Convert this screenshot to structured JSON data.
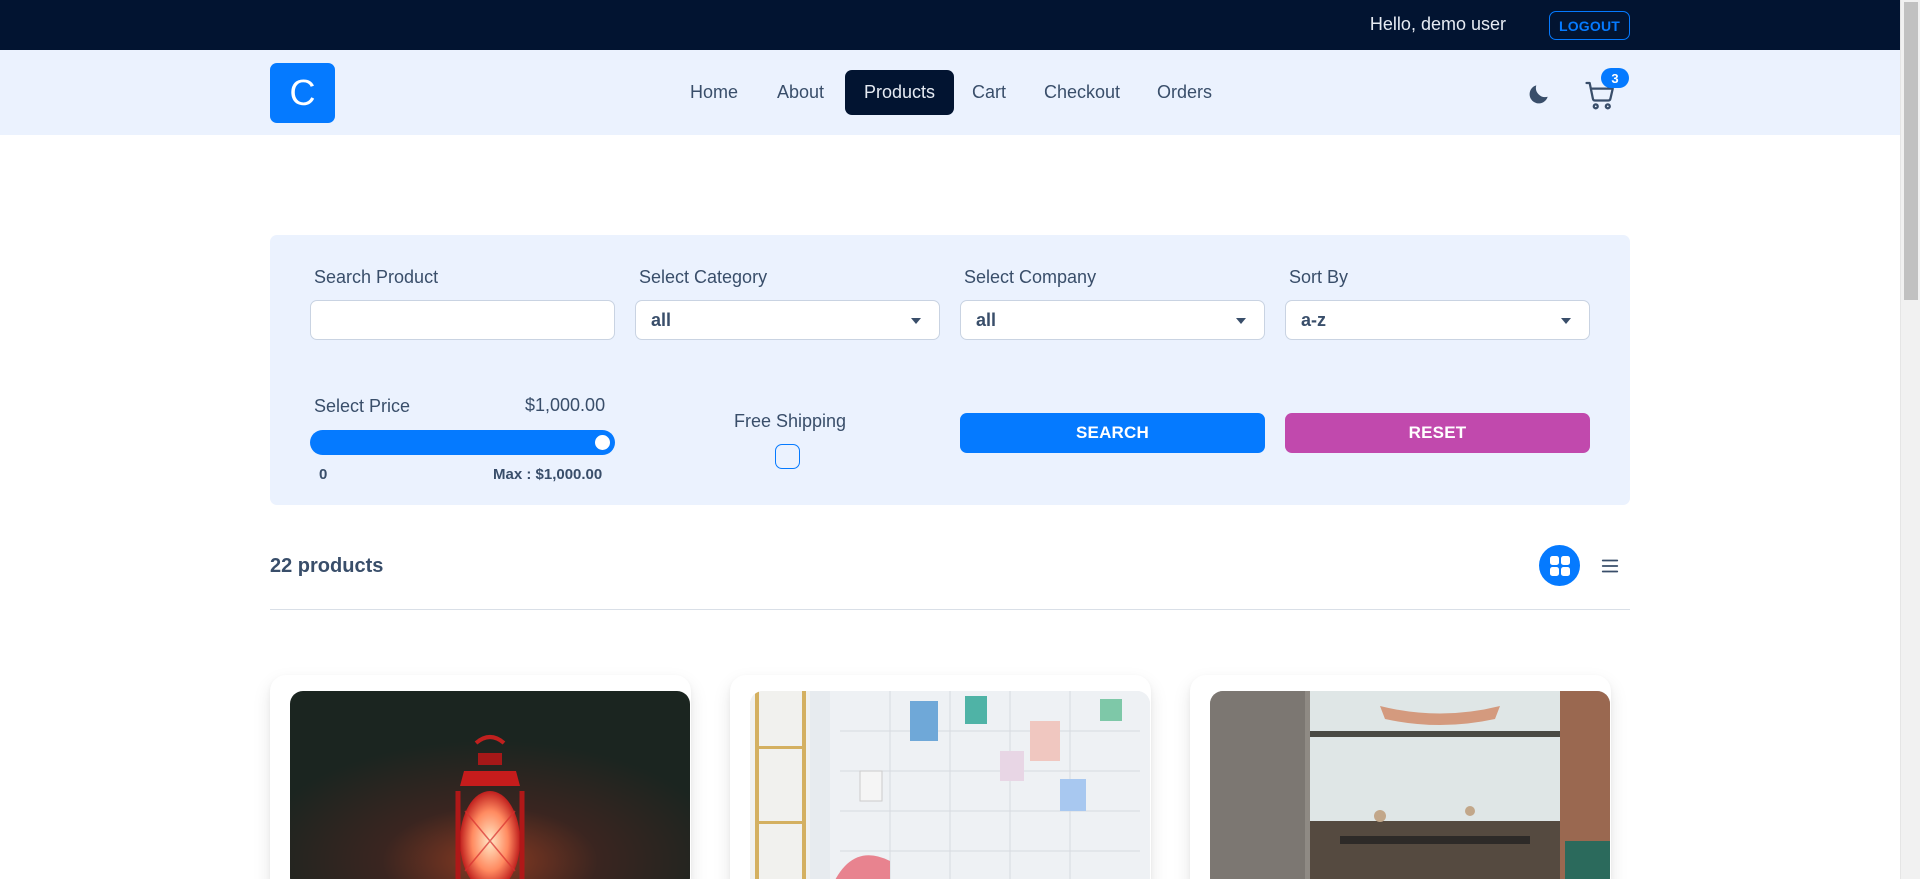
{
  "topbar": {
    "greeting": "Hello, demo user",
    "logout_label": "LOGOUT"
  },
  "navbar": {
    "logo_letter": "C",
    "links": [
      {
        "label": "Home"
      },
      {
        "label": "About"
      },
      {
        "label": "Products"
      },
      {
        "label": "Cart"
      },
      {
        "label": "Checkout"
      },
      {
        "label": "Orders"
      }
    ],
    "active_link": "Products",
    "theme_icon": "moon-icon",
    "cart_icon": "cart-icon",
    "cart_count": "3"
  },
  "filters": {
    "search_label": "Search Product",
    "search_value": "",
    "category_label": "Select Category",
    "category_value": "all",
    "company_label": "Select Company",
    "company_value": "all",
    "sort_label": "Sort By",
    "sort_value": "a-z",
    "price_label": "Select Price",
    "price_value": "$1,000.00",
    "price_min_label": "0",
    "price_max_label": "Max : $1,000.00",
    "price_level": 1.0,
    "shipping_label": "Free Shipping",
    "shipping_checked": false,
    "search_button": "SEARCH",
    "reset_button": "RESET"
  },
  "products": {
    "count_label": "22 products",
    "view_grid_icon": "grid-icon",
    "view_list_icon": "list-icon",
    "active_view": "grid",
    "cards": [
      {
        "image": "lantern-photo"
      },
      {
        "image": "workspace-photo"
      },
      {
        "image": "cafe-interior-photo"
      }
    ]
  },
  "colors": {
    "primary": "#057aff",
    "secondary": "#c149ad",
    "dark": "#021431",
    "panel": "#ebf2fe",
    "text": "#394e6a"
  }
}
